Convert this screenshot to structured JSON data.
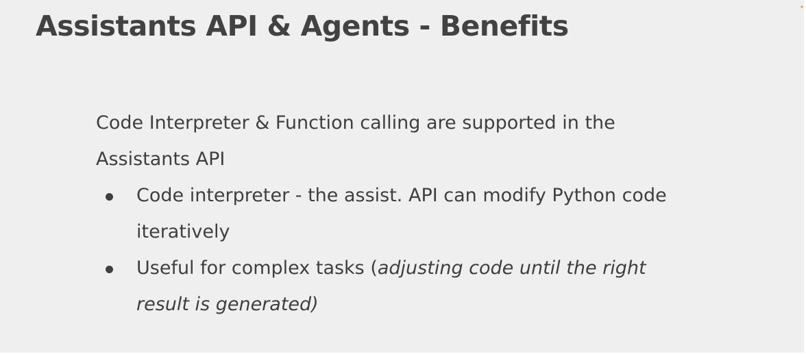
{
  "slide": {
    "title": "Assistants API & Agents - Benefits",
    "intro": "Code Interpreter & Function calling are supported in the Assistants API",
    "bullets": [
      {
        "text": "Code interpreter - the assist. API can modify Python code iteratively"
      },
      {
        "text_prefix": "Useful for complex tasks (",
        "text_italic": "adjusting code until the right result is generated)"
      }
    ]
  },
  "colors": {
    "background": "#efefef",
    "title": "#424242",
    "body_text": "#3f3f3f",
    "accent": "#f08a24"
  }
}
